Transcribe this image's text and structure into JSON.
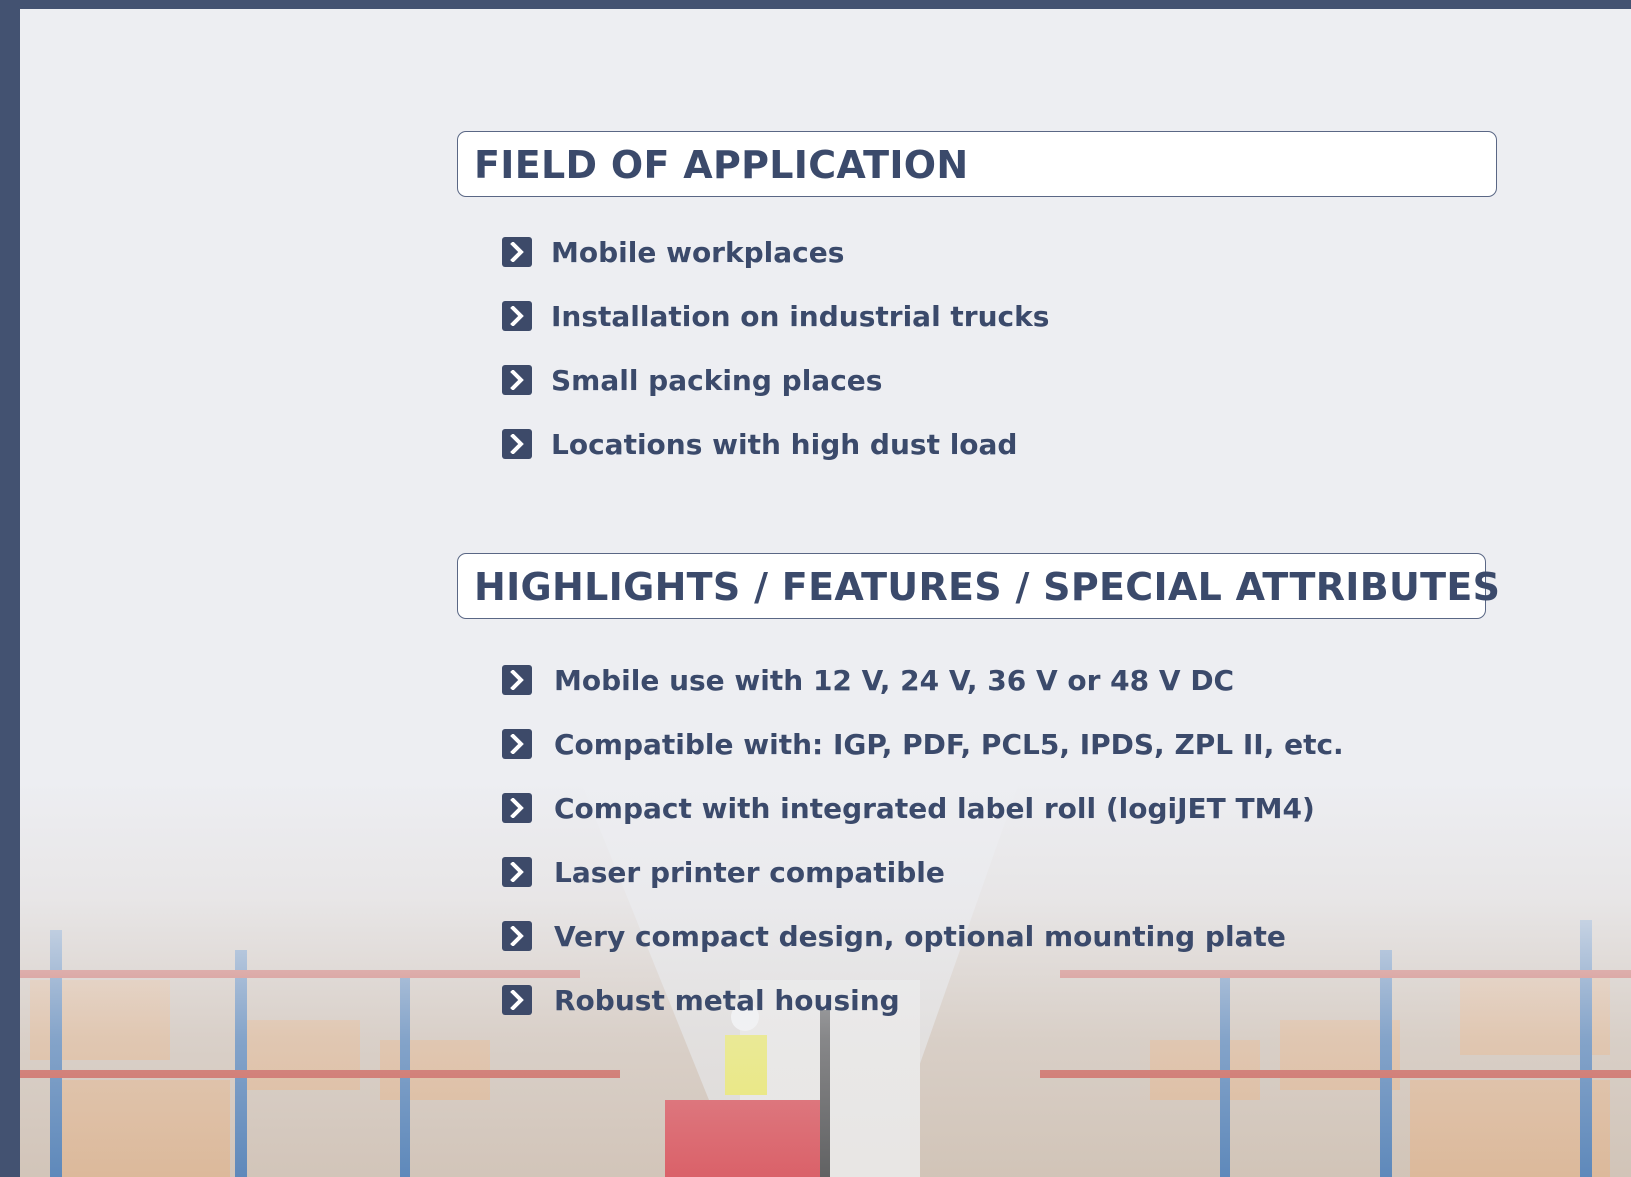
{
  "field_of_application": {
    "title": "FIELD OF APPLICATION",
    "items": [
      "Mobile workplaces",
      "Installation on industrial trucks",
      "Small packing places",
      "Locations with high dust load"
    ]
  },
  "highlights": {
    "title": "HIGHLIGHTS / FEATURES / SPECIAL ATTRIBUTES",
    "items": [
      "Mobile use with 12 V, 24 V, 36 V or 48 V DC",
      "Compatible with: IGP, PDF, PCL5, IPDS, ZPL II, etc.",
      "Compact with integrated label roll (logiJET TM4)",
      "Laser printer compatible",
      "Very compact design, optional mounting plate",
      "Robust metal housing"
    ]
  },
  "colors": {
    "frame": "#435271",
    "text": "#3b4a6b",
    "background": "#edeef2",
    "bullet": "#3d4a69"
  },
  "icons": {
    "bullet": "chevron-right-icon",
    "background_photo": "warehouse-forklift-image"
  }
}
